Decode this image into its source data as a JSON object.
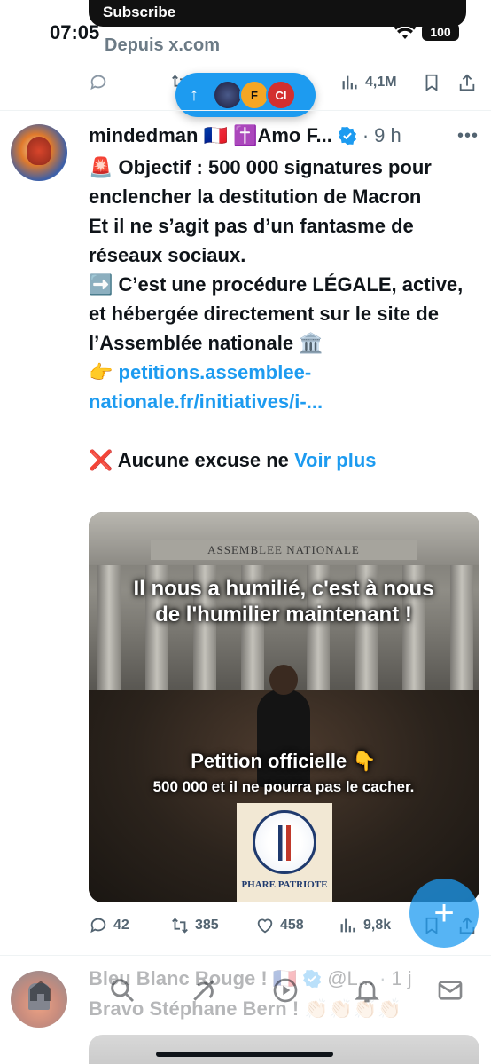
{
  "status_bar": {
    "time": "07:05",
    "banner": "Subscribe",
    "source": "Depuis x.com",
    "battery": "100"
  },
  "prev_tweet": {
    "views": "4,1M"
  },
  "new_posts_pill": {
    "arrow": "↑",
    "avatars": [
      "",
      "F",
      "CI"
    ]
  },
  "tweet": {
    "author_name": "mindedman 🇫🇷 ✝️Amo F...",
    "time_ago": "9 h",
    "body_lines": [
      "🚨 Objectif : 500 000 signatures pour enclencher la destitution de Macron",
      "Et il ne s’agit pas d’un fantasme de réseaux sociaux.",
      "➡️ C’est une procédure LÉGALE, active, et hébergée directement sur le site de l’Assemblée nationale 🏛️"
    ],
    "link_prefix": "👉 ",
    "link_text": "petitions.assemblee-nationale.fr/initiatives/i-...",
    "last_line": "❌ Aucune excuse ne ",
    "see_more": "Voir plus",
    "media": {
      "frieze": "ASSEMBLEE NATIONALE",
      "headline": "Il nous a humilié, c'est à nous de l'humilier maintenant !",
      "caption": "Petition officielle 👇",
      "subcaption": "500 000 et il ne pourra pas le cacher.",
      "badge_text": "PHARE PATRIOTE"
    },
    "stats": {
      "replies": "42",
      "reposts": "385",
      "likes": "458",
      "views": "9,8k"
    }
  },
  "next_tweet": {
    "author_name": "Bleu Blanc Rouge ! 🇫🇷",
    "handle": "@L...",
    "time_ago": "1 j",
    "body": "Bravo Stéphane Bern ! 👏🏻👏🏻👏🏻👏🏻"
  },
  "fab_label": "+"
}
